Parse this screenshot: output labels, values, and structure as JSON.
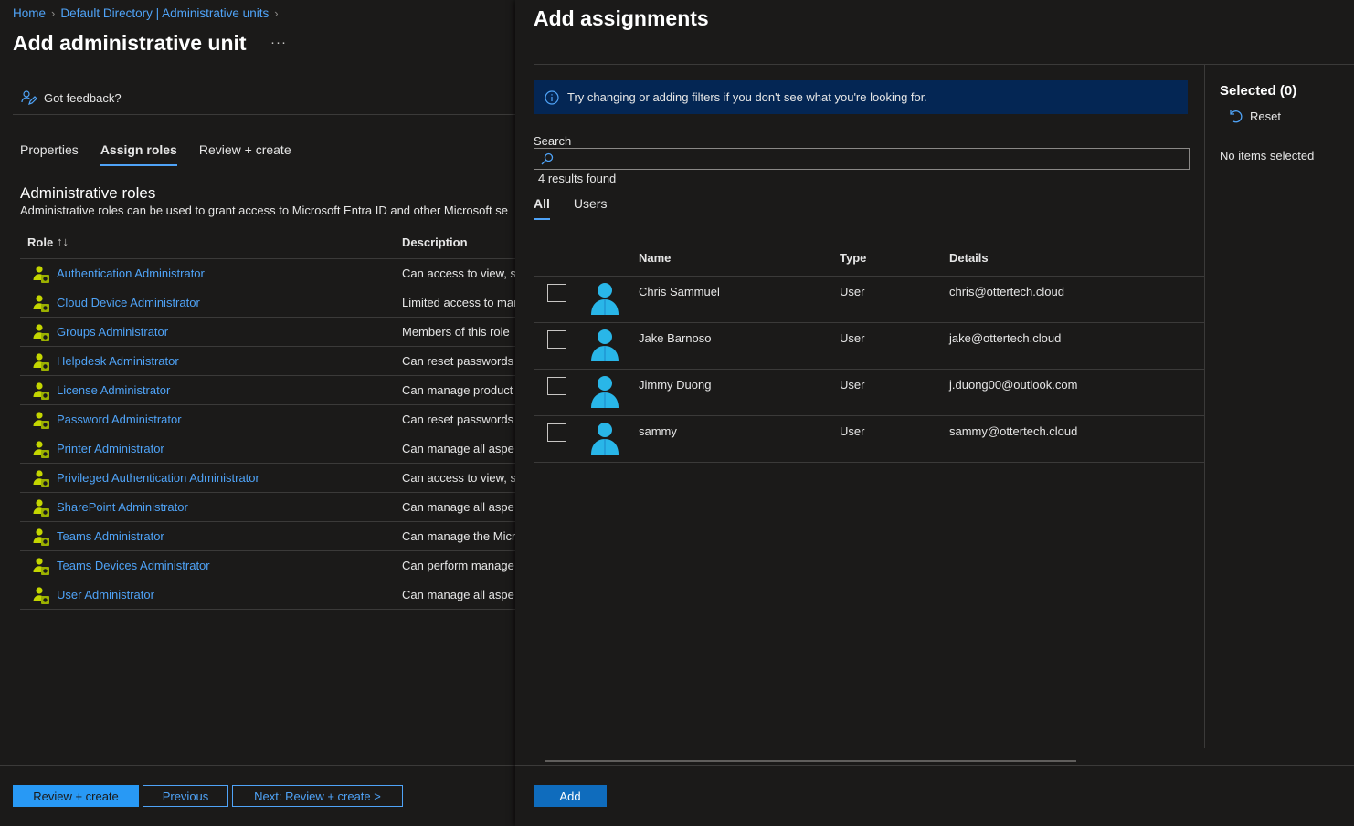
{
  "breadcrumb": {
    "home": "Home",
    "directory": "Default Directory | Administrative units",
    "sep": ">"
  },
  "page": {
    "title": "Add administrative unit",
    "more": "···",
    "feedback": "Got feedback?"
  },
  "tabs": {
    "properties": "Properties",
    "assign_roles": "Assign roles",
    "review_create": "Review + create"
  },
  "roles_section": {
    "title": "Administrative roles",
    "description": "Administrative roles can be used to grant access to Microsoft Entra ID and other Microsoft se",
    "col_role": "Role",
    "sort_indicator": "↑↓",
    "col_description": "Description",
    "rows": [
      {
        "name": "Authentication Administrator",
        "description": "Can access to view, se"
      },
      {
        "name": "Cloud Device Administrator",
        "description": "Limited access to man"
      },
      {
        "name": "Groups Administrator",
        "description": "Members of this role"
      },
      {
        "name": "Helpdesk Administrator",
        "description": "Can reset passwords"
      },
      {
        "name": "License Administrator",
        "description": "Can manage product"
      },
      {
        "name": "Password Administrator",
        "description": "Can reset passwords"
      },
      {
        "name": "Printer Administrator",
        "description": "Can manage all aspe"
      },
      {
        "name": "Privileged Authentication Administrator",
        "description": "Can access to view, se"
      },
      {
        "name": "SharePoint Administrator",
        "description": "Can manage all aspe"
      },
      {
        "name": "Teams Administrator",
        "description": "Can manage the Micr"
      },
      {
        "name": "Teams Devices Administrator",
        "description": "Can perform manage"
      },
      {
        "name": "User Administrator",
        "description": "Can manage all aspe"
      }
    ]
  },
  "footer_left": {
    "review_create": "Review + create",
    "previous": "Previous",
    "next": "Next: Review + create >"
  },
  "assignments": {
    "title": "Add assignments",
    "info": "Try changing or adding filters if you don't see what you're looking for.",
    "search_label": "Search",
    "search_value": "",
    "results": "4 results found",
    "tab_all": "All",
    "tab_users": "Users",
    "col_name": "Name",
    "col_type": "Type",
    "col_details": "Details",
    "users": [
      {
        "name": "Chris Sammuel",
        "type": "User",
        "details": "chris@ottertech.cloud"
      },
      {
        "name": "Jake Barnoso",
        "type": "User",
        "details": "jake@ottertech.cloud"
      },
      {
        "name": "Jimmy Duong",
        "type": "User",
        "details": "j.duong00@outlook.com"
      },
      {
        "name": "sammy",
        "type": "User",
        "details": "sammy@ottertech.cloud"
      }
    ],
    "selected_title": "Selected (0)",
    "reset": "Reset",
    "no_items": "No items selected",
    "add": "Add"
  },
  "colors": {
    "background": "#1b1a19",
    "link": "#4fa3f7",
    "primary": "#2899f5",
    "info_bar": "#042654",
    "user_icon": "#29b6e8"
  }
}
